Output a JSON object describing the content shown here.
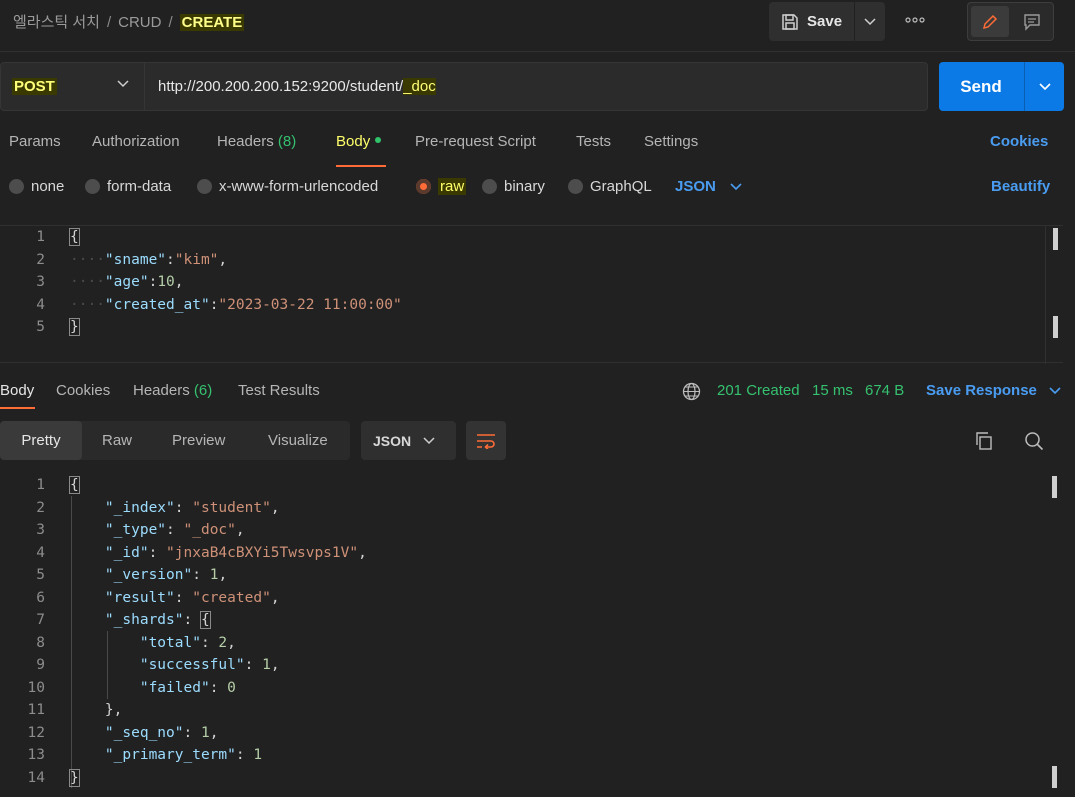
{
  "breadcrumb": {
    "parts": [
      "엘라스틱 서치",
      "CRUD"
    ],
    "current": "CREATE",
    "separator": "/"
  },
  "toolbar": {
    "save_label": "Save"
  },
  "request": {
    "method": "POST",
    "url_prefix": "http://200.200.200.152:9200/student/",
    "url_highlight": "_doc",
    "send_label": "Send"
  },
  "request_tabs": {
    "params": "Params",
    "authorization": "Authorization",
    "headers": "Headers",
    "headers_count": "(8)",
    "body": "Body",
    "prerequest": "Pre-request Script",
    "tests": "Tests",
    "settings": "Settings",
    "cookies": "Cookies"
  },
  "body_types": {
    "none": "none",
    "form_data": "form-data",
    "urlencoded": "x-www-form-urlencoded",
    "raw": "raw",
    "binary": "binary",
    "graphql": "GraphQL",
    "format": "JSON",
    "beautify": "Beautify",
    "selected": "raw"
  },
  "request_body": {
    "line_numbers": [
      "1",
      "2",
      "3",
      "4",
      "5"
    ],
    "open": "{",
    "close": "}",
    "k1": "\"sname\"",
    "v1": "\"kim\"",
    "k2": "\"age\"",
    "v2": "10",
    "k3": "\"created_at\"",
    "v3": "\"2023-03-22 11:00:00\""
  },
  "response_tabs": {
    "body": "Body",
    "cookies": "Cookies",
    "headers": "Headers",
    "headers_count": "(6)",
    "test_results": "Test Results"
  },
  "response_status": {
    "status": "201 Created",
    "time": "15 ms",
    "size": "674 B",
    "save_response": "Save Response"
  },
  "view_tabs": {
    "pretty": "Pretty",
    "raw": "Raw",
    "preview": "Preview",
    "visualize": "Visualize",
    "format": "JSON"
  },
  "response_body": {
    "line_numbers": [
      "1",
      "2",
      "3",
      "4",
      "5",
      "6",
      "7",
      "8",
      "9",
      "10",
      "11",
      "12",
      "13",
      "14"
    ],
    "open": "{",
    "close": "}",
    "shards_close": "},",
    "k_index": "\"_index\"",
    "v_index": "\"student\"",
    "k_type": "\"_type\"",
    "v_type": "\"_doc\"",
    "k_id": "\"_id\"",
    "v_id": "\"jnxaB4cBXYi5Twsvps1V\"",
    "k_version": "\"_version\"",
    "v_version": "1",
    "k_result": "\"result\"",
    "v_result": "\"created\"",
    "k_shards": "\"_shards\"",
    "k_total": "\"total\"",
    "v_total": "2",
    "k_successful": "\"successful\"",
    "v_successful": "1",
    "k_failed": "\"failed\"",
    "v_failed": "0",
    "k_seq": "\"_seq_no\"",
    "v_seq": "1",
    "k_primary": "\"_primary_term\"",
    "v_primary": "1"
  },
  "colors": {
    "accent_orange": "#ff6c37",
    "send_blue": "#0c7ae6",
    "link_blue": "#4a9cf1",
    "status_green": "#35c16f",
    "highlight_yellow": "#ffff7a"
  }
}
